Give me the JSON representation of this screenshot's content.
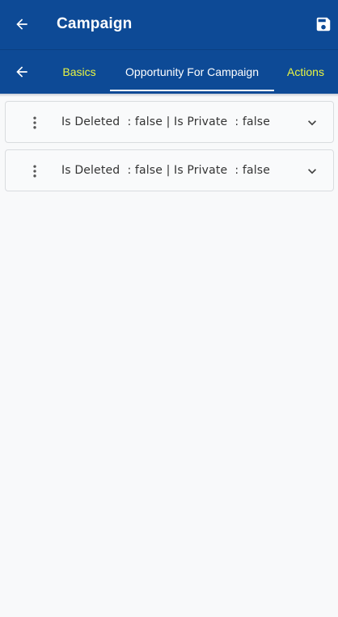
{
  "app_bar": {
    "title": "Campaign",
    "back_icon": "arrow-left-icon",
    "save_icon": "save-icon"
  },
  "tabs": {
    "back_icon": "arrow-left-icon",
    "items": [
      {
        "label": "Basics",
        "active": false
      },
      {
        "label": "Opportunity For Campaign",
        "active": true
      },
      {
        "label": "Actions",
        "active": false
      }
    ]
  },
  "records": [
    {
      "summary": "Is Deleted  : false | Is Private  : false"
    },
    {
      "summary": "Is Deleted  : false | Is Private  : false"
    }
  ],
  "colors": {
    "primary": "#0d4a96",
    "tab_inactive": "#e9f542",
    "tab_active": "#ffffff",
    "background": "#f8f9fa"
  }
}
